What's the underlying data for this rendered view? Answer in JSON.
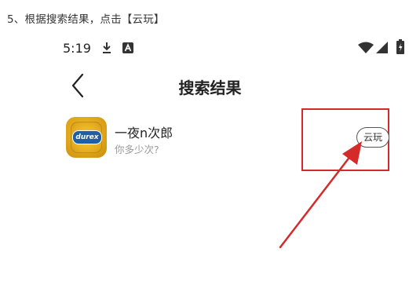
{
  "caption": "5、根据搜索结果，点击【云玩】",
  "status_bar": {
    "time": "5:19",
    "icons": [
      "download-icon",
      "a-icon",
      "wifi-icon",
      "signal-icon",
      "battery-icon"
    ]
  },
  "header": {
    "back_icon": "chevron-left-icon",
    "title": "搜索结果"
  },
  "result": {
    "icon": "durex",
    "name": "一夜n次郎",
    "subtitle": "你多少次?",
    "button_label": "云玩"
  },
  "annotation": {
    "box_color": "#d42a2a",
    "arrow_color": "#d42a2a"
  }
}
